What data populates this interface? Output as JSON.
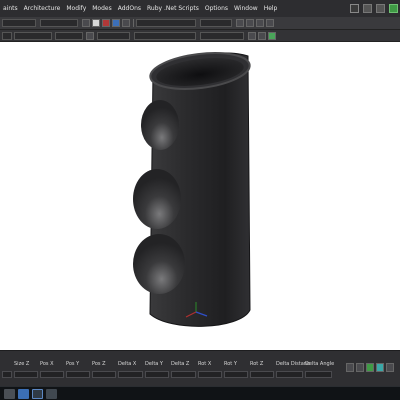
{
  "menubar": {
    "items": [
      "aints",
      "Architecture",
      "Modify",
      "Modes",
      "AddOns",
      "Ruby .Net Scripts",
      "Options",
      "Window",
      "Help"
    ]
  },
  "attributes": {
    "labels": [
      "Size Z",
      "Pos X",
      "Pos Y",
      "Pos Z",
      "Delta X",
      "Delta Y",
      "Delta Z",
      "Rot X",
      "Rot Y",
      "Rot Z",
      "Delta Distanc",
      "Delta Angle"
    ]
  },
  "colors": {
    "menubar_bg": "#2d2d30",
    "toolbar_bg": "#3a3a3d",
    "viewport_bg": "#ffffff",
    "model": "#2a2a2c",
    "taskbar_bg": "#101316",
    "accent_green": "#3f9a45"
  },
  "icons": {
    "window_controls": [
      "pointer-icon",
      "window-icon",
      "grid-icon",
      "green-cube-icon"
    ],
    "viewport_gizmo": "axis-gizmo-icon",
    "taskbar": [
      "start-icon",
      "app-icon",
      "folder-icon",
      "mail-icon"
    ]
  }
}
